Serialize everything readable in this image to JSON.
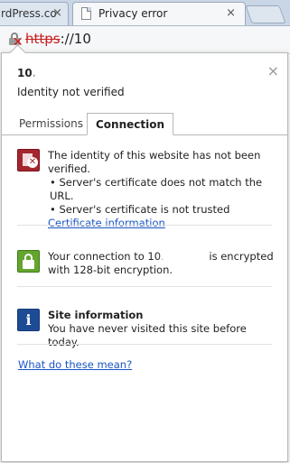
{
  "browser": {
    "tabs": [
      {
        "title": "rdPress.co",
        "active": false
      },
      {
        "title": "Privacy error",
        "active": true
      }
    ],
    "close_glyph": "×",
    "url": {
      "scheme": "https",
      "rest": "://10"
    }
  },
  "popup": {
    "site_title": "10.",
    "subtitle": "Identity not verified",
    "close_glyph": "×",
    "tabs": [
      {
        "label": "Permissions",
        "active": false
      },
      {
        "label": "Connection",
        "active": true
      }
    ],
    "identity": {
      "icon": "certificate-error-icon",
      "text": "The identity of this website has not been verified.",
      "bullets": [
        "• Server's certificate does not match the URL.",
        "• Server's certificate is not trusted"
      ],
      "link": "Certificate information"
    },
    "connection": {
      "icon": "lock-icon",
      "text_before": "Your connection to 10.",
      "text_after": "is encrypted with 128-bit encryption."
    },
    "site_info": {
      "icon": "info-icon",
      "heading": "Site information",
      "text": "You have never visited this site before today."
    },
    "help_link": "What do these mean?"
  },
  "colors": {
    "error_red": "#a4262e",
    "secure_green": "#63a52f",
    "info_blue": "#1e4c94",
    "link_blue": "#1a55c4"
  }
}
